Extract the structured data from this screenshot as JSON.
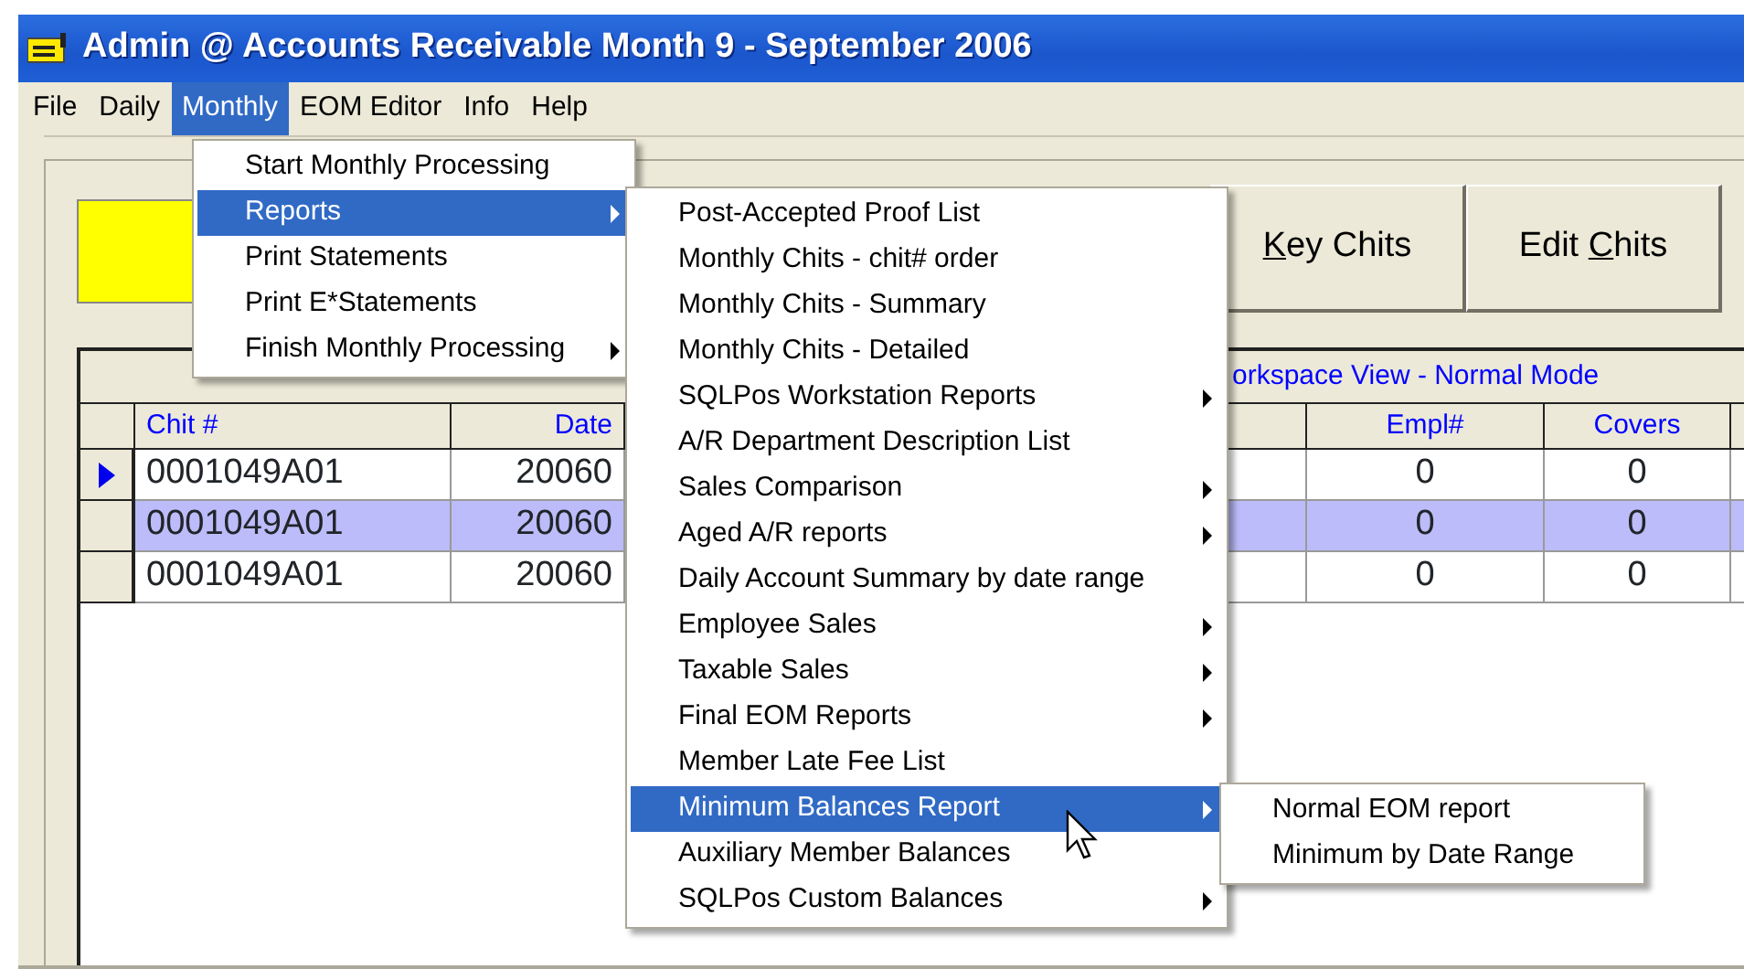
{
  "window": {
    "title": "Admin @ Accounts Receivable Month 9 - September 2006"
  },
  "menu_bar": [
    {
      "label": "File",
      "selected": false
    },
    {
      "label": "Daily",
      "selected": false
    },
    {
      "label": "Monthly",
      "selected": true
    },
    {
      "label": "EOM Editor",
      "selected": false
    },
    {
      "label": "Info",
      "selected": false
    },
    {
      "label": "Help",
      "selected": false
    }
  ],
  "buttons": [
    {
      "mnemonic": "K",
      "after": "ey Chits"
    },
    {
      "before": "Edit ",
      "mnemonic": "C",
      "after": "hits"
    }
  ],
  "grid": {
    "caption": "orkspace View - Normal Mode",
    "columns": [
      {
        "label": "Chit #"
      },
      {
        "label": "Date"
      },
      {
        "label": "Empl#"
      },
      {
        "label": "Covers"
      }
    ],
    "rows": [
      {
        "current": true,
        "selected": false,
        "cells": [
          "0001049A01",
          "20060",
          "0",
          "0"
        ]
      },
      {
        "current": false,
        "selected": true,
        "cells": [
          "0001049A01",
          "20060",
          "0",
          "0"
        ]
      },
      {
        "current": false,
        "selected": false,
        "cells": [
          "0001049A01",
          "20060",
          "0",
          "0"
        ]
      }
    ]
  },
  "monthly_menu": [
    {
      "label": "Start Monthly Processing",
      "submenu": false,
      "selected": false
    },
    {
      "label": "Reports",
      "submenu": true,
      "selected": true
    },
    {
      "label": "Print Statements",
      "submenu": false,
      "selected": false
    },
    {
      "label": "Print E*Statements",
      "submenu": false,
      "selected": false
    },
    {
      "label": "Finish Monthly Processing",
      "submenu": true,
      "selected": false
    }
  ],
  "reports_menu": [
    {
      "label": "Post-Accepted Proof List",
      "submenu": false,
      "selected": false
    },
    {
      "label": "Monthly Chits - chit# order",
      "submenu": false,
      "selected": false
    },
    {
      "label": "Monthly Chits - Summary",
      "submenu": false,
      "selected": false
    },
    {
      "label": "Monthly Chits - Detailed",
      "submenu": false,
      "selected": false
    },
    {
      "label": "SQLPos Workstation Reports",
      "submenu": true,
      "selected": false
    },
    {
      "label": "A/R Department Description List",
      "submenu": false,
      "selected": false
    },
    {
      "label": "Sales Comparison",
      "submenu": true,
      "selected": false
    },
    {
      "label": "Aged A/R reports",
      "submenu": true,
      "selected": false
    },
    {
      "label": "Daily Account Summary by date range",
      "submenu": false,
      "selected": false
    },
    {
      "label": "Employee Sales",
      "submenu": true,
      "selected": false
    },
    {
      "label": "Taxable Sales",
      "submenu": true,
      "selected": false
    },
    {
      "label": "Final EOM Reports",
      "submenu": true,
      "selected": false
    },
    {
      "label": "Member Late Fee List",
      "submenu": false,
      "selected": false
    },
    {
      "label": "Minimum Balances Report",
      "submenu": true,
      "selected": true
    },
    {
      "label": "Auxiliary Member Balances",
      "submenu": false,
      "selected": false
    },
    {
      "label": "SQLPos Custom Balances",
      "submenu": true,
      "selected": false
    }
  ],
  "minimum_menu": [
    {
      "label": "Normal EOM report",
      "submenu": false,
      "selected": false
    },
    {
      "label": "Minimum by Date Range",
      "submenu": false,
      "selected": false
    }
  ]
}
